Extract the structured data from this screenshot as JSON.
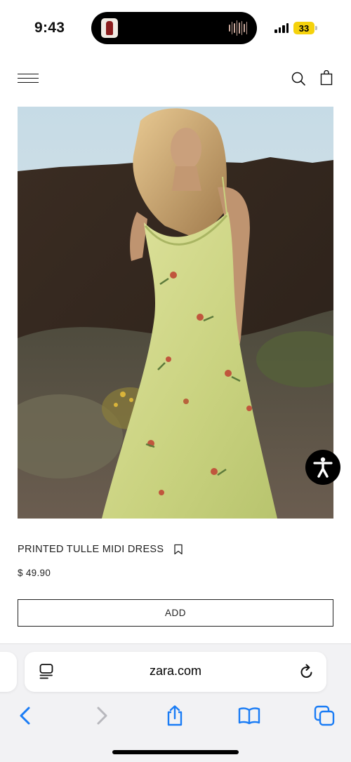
{
  "status_bar": {
    "time": "9:43",
    "battery": "33",
    "colors": {
      "battery": "#f5d20c"
    }
  },
  "header": {
    "menu_icon": "hamburger-menu-icon",
    "search_icon": "search-icon",
    "bag_icon": "shopping-bag-icon"
  },
  "product": {
    "title": "PRINTED TULLE MIDI DRESS",
    "price": "$ 49.90",
    "add_label": "ADD",
    "bookmark_icon": "bookmark-icon",
    "image_icon": "product-photo"
  },
  "accessibility": {
    "icon": "accessibility-icon"
  },
  "browser": {
    "url": "zara.com",
    "reader_icon": "reader-mode-icon",
    "reload_icon": "reload-icon",
    "toolbar": [
      "back-icon",
      "forward-icon",
      "share-icon",
      "bookmarks-icon",
      "tabs-icon"
    ],
    "colors": {
      "accent": "#1a7cf5",
      "disabled": "#b8b8bd"
    }
  }
}
